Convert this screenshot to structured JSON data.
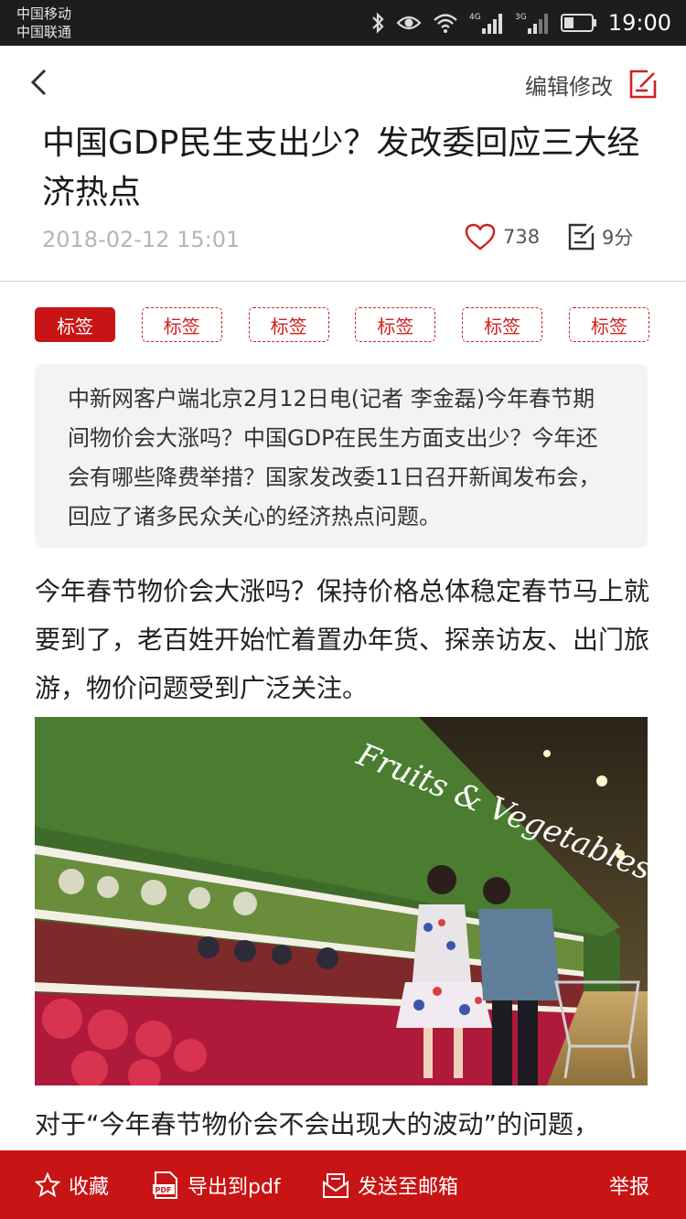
{
  "status_bar": {
    "carrier_1": "中国移动",
    "carrier_2": "中国联通",
    "time": "19:00",
    "icons": [
      "bluetooth-icon",
      "eye-icon",
      "wifi-icon",
      "4g-signal-icon",
      "3g-signal-icon",
      "battery-icon"
    ]
  },
  "header": {
    "edit_label": "编辑修改",
    "title": "中国GDP民生支出少？发改委回应三大经济热点",
    "date": "2018-02-12 15:01",
    "like_count": "738",
    "score": "9分"
  },
  "tags": [
    "标签",
    "标签",
    "标签",
    "标签",
    "标签",
    "标签"
  ],
  "summary": "中新网客户端北京2月12日电(记者 李金磊)今年春节期间物价会大涨吗？中国GDP在民生方面支出少？今年还会有哪些降费举措？国家发改委11日召开新闻发布会，回应了诸多民众关心的经济热点问题。",
  "body": {
    "paragraph_1": "今年春节物价会大涨吗？保持价格总体稳定春节马上就要到了，老百姓开始忙着置办年货、探亲访友、出门旅游，物价问题受到广泛关注。",
    "photo_sign": "Fruits & Vegetables",
    "paragraph_2": "对于“今年春节物价会不会出现大的波动”的问题，"
  },
  "bottom_bar": {
    "favorite": "收藏",
    "export_pdf": "导出到pdf",
    "pdf_badge": "PDF",
    "send_email": "发送至邮箱",
    "report": "举报"
  },
  "colors": {
    "accent": "#c81414",
    "status_bar": "#1d1d1d",
    "summary_bg": "#f3f3f3",
    "date_text": "#b5b5b5"
  }
}
